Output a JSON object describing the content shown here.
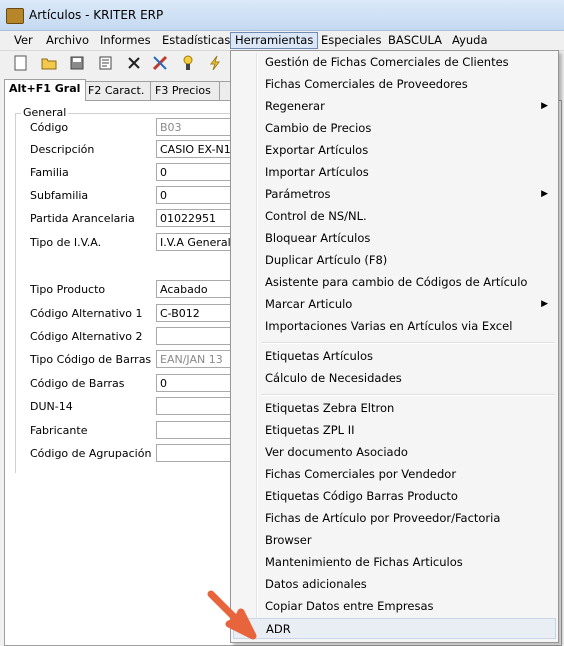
{
  "window": {
    "title": "Artículos - KRITER ERP"
  },
  "menubar": {
    "items": [
      "Ver",
      "Archivo",
      "Informes",
      "Estadísticas",
      "Herramientas",
      "Especiales",
      "BASCULA",
      "Ayuda"
    ],
    "active": "Herramientas"
  },
  "tabs": [
    "Alt+F1 Gral",
    "F2 Caract.",
    "F3 Precios",
    ""
  ],
  "form": {
    "group_title": "General",
    "fields": [
      {
        "label": "Código",
        "value": "B03"
      },
      {
        "label": "Descripción",
        "value": "CASIO EX-N1 I"
      },
      {
        "label": "Familia",
        "value": "0"
      },
      {
        "label": "Subfamilia",
        "value": "0"
      },
      {
        "label": "Partida Arancelaria",
        "value": "01022951"
      },
      {
        "label": "Tipo de I.V.A.",
        "value": "I.V.A General 2"
      },
      {
        "label": "Tipo Producto",
        "value": "Acabado"
      },
      {
        "label": "Código Alternativo 1",
        "value": "C-B012"
      },
      {
        "label": "Código Alternativo 2",
        "value": ""
      },
      {
        "label": "Tipo Código de Barras",
        "value": "EAN/JAN 13"
      },
      {
        "label": "Código de Barras",
        "value": "0"
      },
      {
        "label": "DUN-14",
        "value": ""
      },
      {
        "label": "Fabricante",
        "value": ""
      },
      {
        "label": "Código de Agrupación",
        "value": ""
      }
    ]
  },
  "herramientas_menu": [
    "Gestión de Fichas Comerciales de Clientes",
    "Fichas Comerciales de Proveedores",
    "Regenerar",
    "Cambio de Precios",
    "Exportar Artículos",
    "Importar Artículos",
    "Parámetros",
    "Control de NS/NL.",
    "Bloquear Artículos",
    "Duplicar Artículo (F8)",
    "Asistente para cambio de Códigos de Artículo",
    "Marcar Articulo",
    "Importaciones Varias en Artículos via Excel",
    "Etiquetas Artículos",
    "Cálculo de Necesidades",
    "Etiquetas Zebra Eltron",
    "Etiquetas ZPL II",
    "Ver documento Asociado",
    "Fichas Comerciales por Vendedor",
    "Etiquetas Código Barras Producto",
    "Fichas de Artículo por Proveedor/Factoria",
    "Browser",
    "Mantenimiento de Fichas Articulos",
    "Datos adicionales",
    "Copiar Datos entre Empresas",
    "ADR"
  ],
  "colors": {
    "highlight": "#e9eef5",
    "arrow": "#e8643c",
    "titlebar": "#c4d9f1"
  }
}
